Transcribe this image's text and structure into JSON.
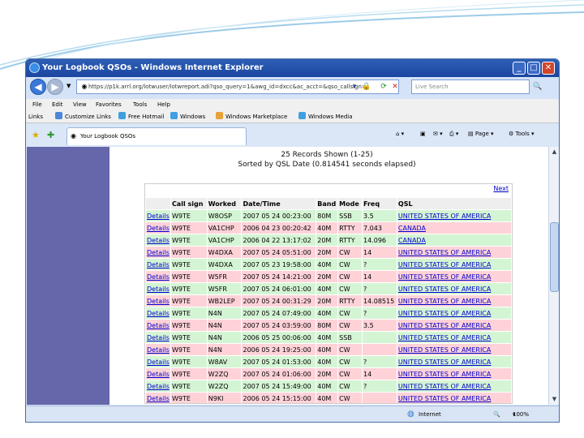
{
  "window": {
    "title": "Your Logbook QSOs - Windows Internet Explorer"
  },
  "address": {
    "url": "https://p1k.arrl.org/lotwuser/lotwreport.adi?qso_query=1&awg_id=dxcc&ac_acct=&qso_callsign=",
    "search_placeholder": "Live Search"
  },
  "menu": [
    "File",
    "Edit",
    "View",
    "Favorites",
    "Tools",
    "Help"
  ],
  "links": {
    "label": "Links",
    "items": [
      "Customize Links",
      "Free Hotmail",
      "Windows",
      "Windows Marketplace",
      "Windows Media"
    ]
  },
  "tab": {
    "title": "Your Logbook QSOs"
  },
  "toolbar": {
    "page": "Page",
    "tools": "Tools"
  },
  "report": {
    "shown": "25 Records Shown (1-25)",
    "sorted": "Sorted by QSL Date (0.814541 seconds elapsed)",
    "next": "Next"
  },
  "table": {
    "headers": [
      "",
      "Call sign",
      "Worked",
      "Date/Time",
      "Band",
      "Mode",
      "Freq",
      "QSL"
    ],
    "rows": [
      {
        "style": "green",
        "details": "Details",
        "call": "W9TE",
        "worked": "W8OSP",
        "datetime": "2007 05 24 00:23:00",
        "band": "80M",
        "mode": "SSB",
        "freq": "3.5",
        "qsl": "UNITED STATES OF AMERICA"
      },
      {
        "style": "pink",
        "details": "Details",
        "call": "W9TE",
        "worked": "VA1CHP",
        "datetime": "2006 04 23 00:20:42",
        "band": "40M",
        "mode": "RTTY",
        "freq": "7.043",
        "qsl": "CANADA"
      },
      {
        "style": "green",
        "details": "Details",
        "call": "W9TE",
        "worked": "VA1CHP",
        "datetime": "2006 04 22 13:17:02",
        "band": "20M",
        "mode": "RTTY",
        "freq": "14.096",
        "qsl": "CANADA"
      },
      {
        "style": "pink",
        "details": "Details",
        "call": "W9TE",
        "worked": "W4DXA",
        "datetime": "2007 05 24 05:51:00",
        "band": "20M",
        "mode": "CW",
        "freq": "14",
        "qsl": "UNITED STATES OF AMERICA"
      },
      {
        "style": "green",
        "details": "Details",
        "call": "W9TE",
        "worked": "W4DXA",
        "datetime": "2007 05 23 19:58:00",
        "band": "40M",
        "mode": "CW",
        "freq": "?",
        "qsl": "UNITED STATES OF AMERICA"
      },
      {
        "style": "pink",
        "details": "Details",
        "call": "W9TE",
        "worked": "W5FR",
        "datetime": "2007 05 24 14:21:00",
        "band": "20M",
        "mode": "CW",
        "freq": "14",
        "qsl": "UNITED STATES OF AMERICA"
      },
      {
        "style": "green",
        "details": "Details",
        "call": "W9TE",
        "worked": "W5FR",
        "datetime": "2007 05 24 06:01:00",
        "band": "40M",
        "mode": "CW",
        "freq": "?",
        "qsl": "UNITED STATES OF AMERICA"
      },
      {
        "style": "pink",
        "details": "Details",
        "call": "W9TE",
        "worked": "WB2LEP",
        "datetime": "2007 05 24 00:31:29",
        "band": "20M",
        "mode": "RTTY",
        "freq": "14.08515",
        "qsl": "UNITED STATES OF AMERICA"
      },
      {
        "style": "green",
        "details": "Details",
        "call": "W9TE",
        "worked": "N4N",
        "datetime": "2007 05 24 07:49:00",
        "band": "40M",
        "mode": "CW",
        "freq": "?",
        "qsl": "UNITED STATES OF AMERICA"
      },
      {
        "style": "pink",
        "details": "Details",
        "call": "W9TE",
        "worked": "N4N",
        "datetime": "2007 05 24 03:59:00",
        "band": "80M",
        "mode": "CW",
        "freq": "3.5",
        "qsl": "UNITED STATES OF AMERICA"
      },
      {
        "style": "green",
        "details": "Details",
        "call": "W9TE",
        "worked": "N4N",
        "datetime": "2006 05 25 00:06:00",
        "band": "40M",
        "mode": "SSB",
        "freq": "",
        "qsl": "UNITED STATES OF AMERICA"
      },
      {
        "style": "pink",
        "details": "Details",
        "call": "W9TE",
        "worked": "N4N",
        "datetime": "2006 05 24 19:25:00",
        "band": "40M",
        "mode": "CW",
        "freq": "",
        "qsl": "UNITED STATES OF AMERICA"
      },
      {
        "style": "green",
        "details": "Details",
        "call": "W9TE",
        "worked": "W8AV",
        "datetime": "2007 05 24 01:53:00",
        "band": "40M",
        "mode": "CW",
        "freq": "?",
        "qsl": "UNITED STATES OF AMERICA"
      },
      {
        "style": "pink",
        "details": "Details",
        "call": "W9TE",
        "worked": "W2ZQ",
        "datetime": "2007 05 24 01:06:00",
        "band": "20M",
        "mode": "CW",
        "freq": "14",
        "qsl": "UNITED STATES OF AMERICA"
      },
      {
        "style": "green",
        "details": "Details",
        "call": "W9TE",
        "worked": "W2ZQ",
        "datetime": "2007 05 24 15:49:00",
        "band": "40M",
        "mode": "CW",
        "freq": "?",
        "qsl": "UNITED STATES OF AMERICA"
      },
      {
        "style": "pink",
        "details": "Details",
        "call": "W9TE",
        "worked": "N9KI",
        "datetime": "2006 05 24 15:15:00",
        "band": "40M",
        "mode": "CW",
        "freq": "",
        "qsl": "UNITED STATES OF AMERICA"
      }
    ]
  },
  "status": {
    "zone": "Internet",
    "zoom": "100%"
  },
  "colors": {
    "sidebar": "#6666aa",
    "row_pink": "#ffd2d8",
    "row_green": "#d4f5d4",
    "link": "#0000cc"
  }
}
